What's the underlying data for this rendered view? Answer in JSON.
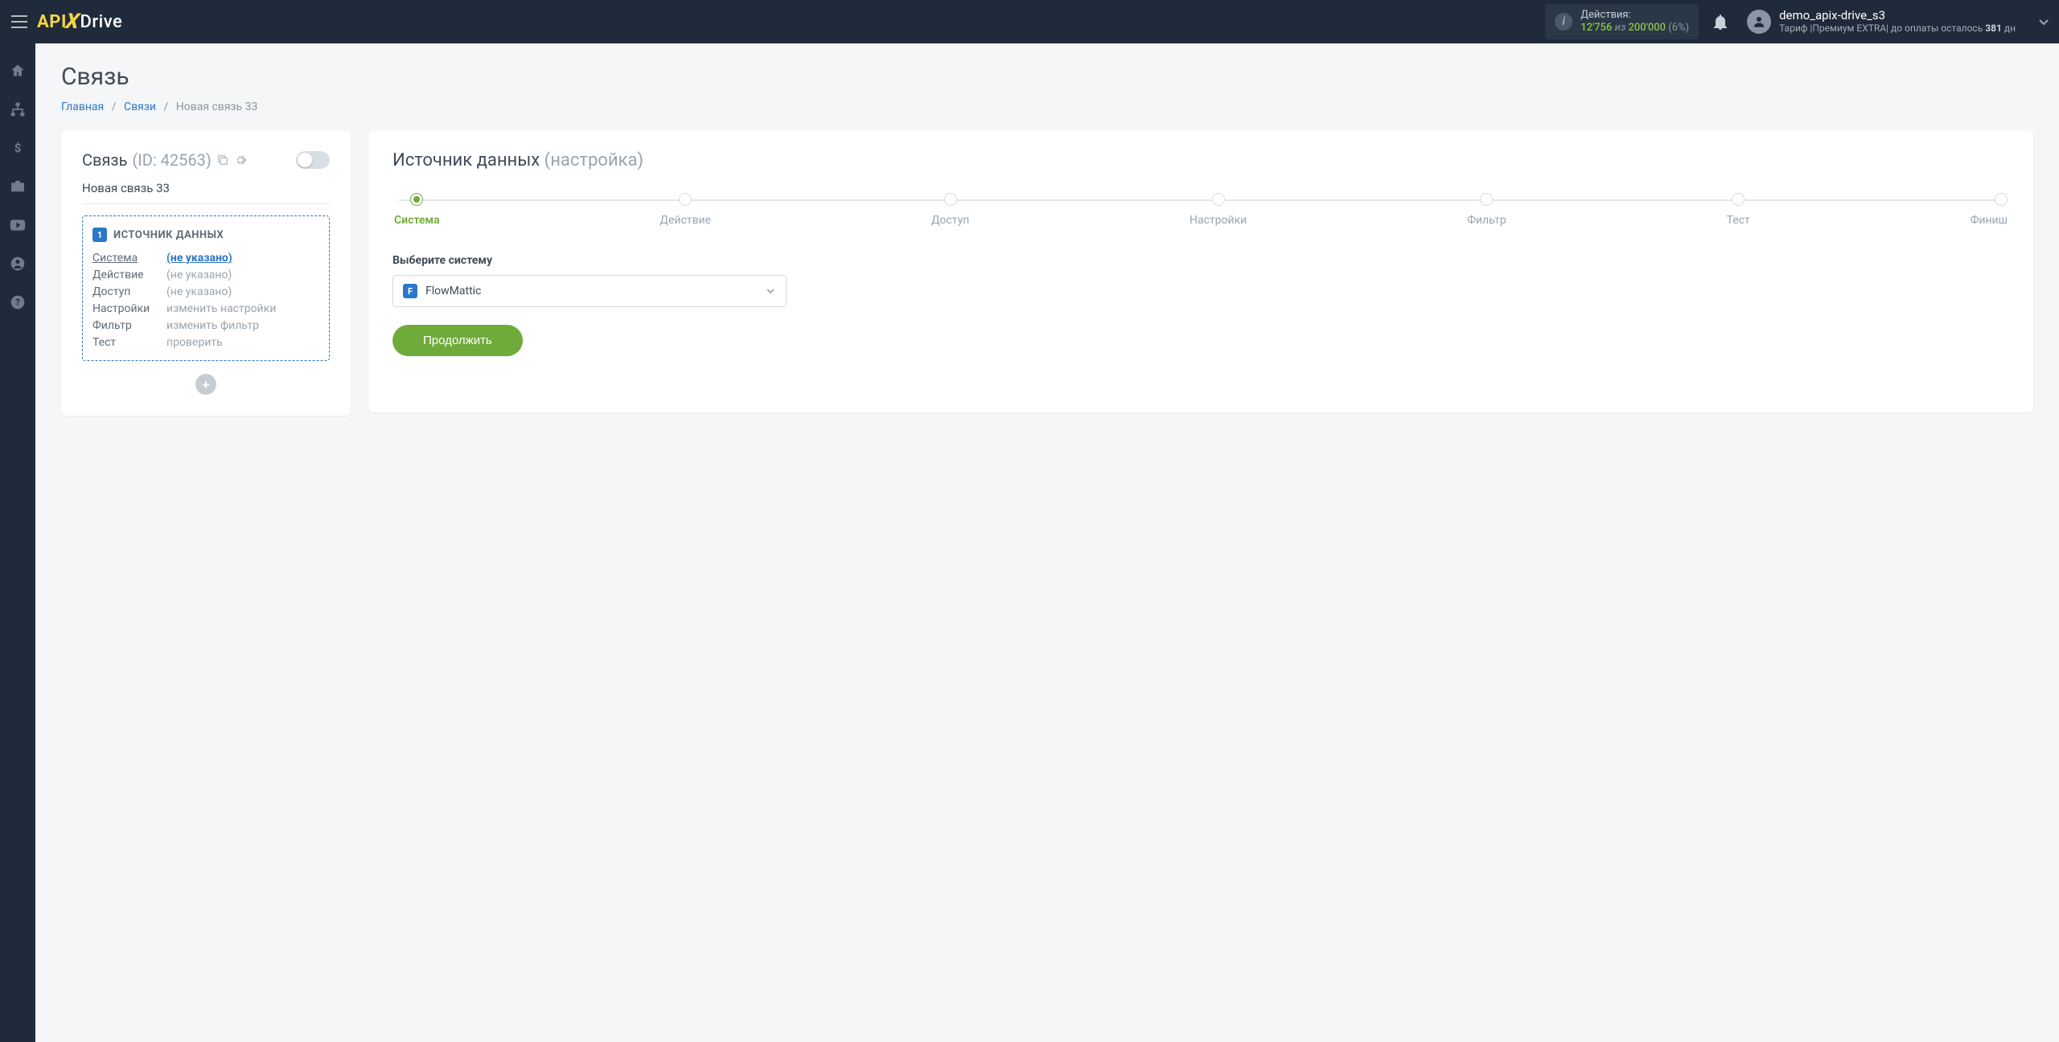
{
  "header": {
    "logo": {
      "api": "API",
      "x": "X",
      "drive": "Drive"
    },
    "actions": {
      "label": "Действия:",
      "count": "12'756",
      "of": "из",
      "limit": "200'000",
      "pct": "(6%)"
    },
    "user": {
      "name": "demo_apix-drive_s3",
      "tariff_prefix": "Тариф |Премиум EXTRA| до оплаты осталось ",
      "days": "381",
      "tariff_suffix": " дн"
    }
  },
  "page": {
    "title": "Связь",
    "crumbs": {
      "home": "Главная",
      "links": "Связи",
      "current": "Новая связь 33"
    }
  },
  "connection": {
    "title_label": "Связь",
    "title_id": "(ID: 42563)",
    "name": "Новая связь 33",
    "block_num": "1",
    "block_title": "ИСТОЧНИК ДАННЫХ",
    "rows": {
      "system": {
        "k": "Система",
        "v": "(не указано)"
      },
      "action": {
        "k": "Действие",
        "v": "(не указано)"
      },
      "access": {
        "k": "Доступ",
        "v": "(не указано)"
      },
      "settings": {
        "k": "Настройки",
        "v": "изменить настройки"
      },
      "filter": {
        "k": "Фильтр",
        "v": "изменить фильтр"
      },
      "test": {
        "k": "Тест",
        "v": "проверить"
      }
    }
  },
  "setup": {
    "title_main": "Источник данных",
    "title_sub": "(настройка)",
    "steps": [
      "Система",
      "Действие",
      "Доступ",
      "Настройки",
      "Фильтр",
      "Тест",
      "Финиш"
    ],
    "field_label": "Выберите систему",
    "selected_system": "FlowMattic",
    "continue": "Продолжить"
  }
}
